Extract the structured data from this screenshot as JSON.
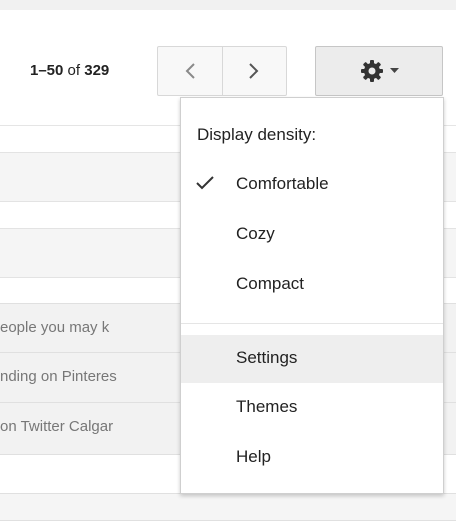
{
  "pager": {
    "range": "1–50",
    "of_label": "of",
    "total": "329"
  },
  "nav": {
    "prev_icon": "chevron-left-icon",
    "next_icon": "chevron-right-icon"
  },
  "settings_button": {
    "icon": "gear-icon",
    "caret_icon": "caret-down-icon"
  },
  "email_rows": [
    {
      "snippet": "eople you may k"
    },
    {
      "snippet": "nding on Pinteres"
    },
    {
      "snippet": "on Twitter Calgar"
    }
  ],
  "menu": {
    "heading": "Display density:",
    "density_options": [
      {
        "label": "Comfortable",
        "checked": true
      },
      {
        "label": "Cozy",
        "checked": false
      },
      {
        "label": "Compact",
        "checked": false
      }
    ],
    "actions": [
      {
        "label": "Settings",
        "highlighted": true
      },
      {
        "label": "Themes",
        "highlighted": false
      },
      {
        "label": "Help",
        "highlighted": false
      }
    ]
  },
  "colors": {
    "menu_highlight": "#eeeeee",
    "button_bg": "#ececec",
    "text": "#222222",
    "muted_text": "#777777"
  }
}
